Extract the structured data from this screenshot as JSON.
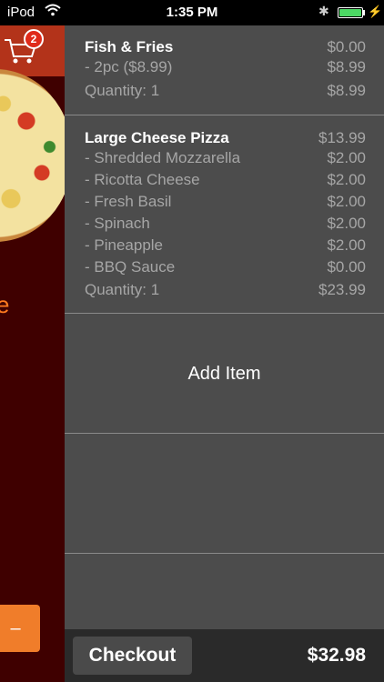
{
  "status_bar": {
    "carrier": "iPod",
    "time": "1:35 PM",
    "battery_level": 1.0
  },
  "side_panel": {
    "cart_badge_count": "2",
    "side_text": "e"
  },
  "cart": {
    "items": [
      {
        "name": "Fish & Fries",
        "price": "$0.00",
        "options": [
          {
            "label": " - 2pc ($8.99)",
            "price": "$8.99"
          }
        ],
        "quantity_label": "Quantity: 1",
        "total": "$8.99"
      },
      {
        "name": "Large Cheese Pizza",
        "price": "$13.99",
        "options": [
          {
            "label": " - Shredded Mozzarella",
            "price": "$2.00"
          },
          {
            "label": " - Ricotta Cheese",
            "price": "$2.00"
          },
          {
            "label": " - Fresh Basil",
            "price": "$2.00"
          },
          {
            "label": " - Spinach",
            "price": "$2.00"
          },
          {
            "label": " - Pineapple",
            "price": "$2.00"
          },
          {
            "label": " - BBQ Sauce",
            "price": "$0.00"
          }
        ],
        "quantity_label": "Quantity: 1",
        "total": "$23.99"
      }
    ],
    "add_item_label": "Add Item"
  },
  "footer": {
    "checkout_label": "Checkout",
    "order_total": "$32.98"
  },
  "colors": {
    "cart_background": "#4c4c4c",
    "side_panel_background": "#3f0000",
    "accent_orange": "#f07d2a",
    "badge_red": "#e02a1a",
    "battery_green": "#4cd964"
  }
}
